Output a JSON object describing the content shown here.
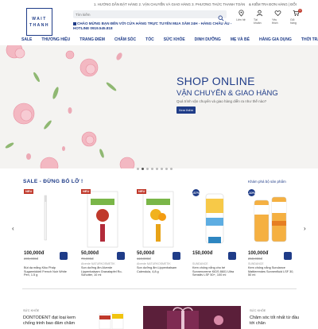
{
  "topbar": {
    "links": "1. HƯỚNG DẪN ĐẶT HÀNG  2. VẬN CHUYỂN VÀ GIAO HÀNG  3. PHƯƠNG THỨC THANH TOÁN",
    "right": "& KIỂM TRA ĐƠN HÀNG | ĐỔI"
  },
  "logo": {
    "line1": "WAIT",
    "line2": "THANH"
  },
  "search": {
    "placeholder": "Tìm kiếm"
  },
  "notice": {
    "line1": "CHÀO MỪNG BẠN ĐẾN VỚI CỬA HÀNG TRỰC TUYẾN MUA SẮM 24H - HÀNG CHÂU ÂU -",
    "line2": "HOTLINE 0919.545.818"
  },
  "header_icons": [
    {
      "label": "Liên hệ",
      "icon": "location-icon"
    },
    {
      "label": "Tài khoản",
      "icon": "user-icon"
    },
    {
      "label": "Yêu thích",
      "icon": "heart-icon"
    },
    {
      "label": "Giỏ hàng",
      "icon": "cart-icon",
      "count": "0"
    }
  ],
  "nav": [
    "SALE",
    "THƯƠNG HIỆU",
    "TRANG ĐIỂM",
    "CHĂM SÓC",
    "TÓC",
    "SỨC KHỎE",
    "DINH DƯỠNG",
    "MẸ VÀ BÉ",
    "HÀNG GIA DỤNG",
    "THỜI TRANG"
  ],
  "hero": {
    "title": "SHOP ONLINE",
    "subtitle": "VẬN CHUYỂN & GIAO HÀNG",
    "desc": "Quá trình vận chuyển và giao hàng diễn ra như thế nào?",
    "button": "Xem thêm"
  },
  "sale": {
    "title": "SALE - ĐỪNG BỎ LỠ !",
    "link": "Khám phá bộ sản phẩm"
  },
  "products": [
    {
      "badge": "NEU",
      "badge_type": "new",
      "price": "100,000đ",
      "old_price": "209,000đ",
      "brand": "",
      "name": "Bút dạ mắng Kiko Phấp Sugarmiddell French Noir White Pen, 1.5 g"
    },
    {
      "badge": "NEU",
      "badge_type": "new",
      "price": "50,000đ",
      "old_price": "79,000đ",
      "brand": "Alverde NATURKOSMETIK",
      "name": "Son dưỡng ẩm Alverde Lippenbalsam Granatapfel Ro-Schutter, 10 ml"
    },
    {
      "badge": "NEU",
      "badge_type": "new",
      "price": "50,000đ",
      "old_price": "118,000đ",
      "brand": "Alverde NATURKOSMETIK",
      "name": "Son dưỡng ẩm Lippenbalsam Calendula, 4,8 g"
    },
    {
      "badge": "-67%",
      "badge_type": "off",
      "price": "150,000đ",
      "old_price": "",
      "brand": "SUNDANCE",
      "name": "Kem chống nắng cho bé Sonnencreme KIDS 8601 Ultra Sensitiv LSF 50+, 100 ml"
    },
    {
      "badge": "-10%",
      "badge_type": "off",
      "price": "100,000đ",
      "old_price": "250,000đ",
      "brand": "SUNDANCE",
      "name": "Kem chống nắng Sundance Mattierendes Sonnenfluid LSF 30, 50 ml"
    }
  ],
  "bottom": [
    {
      "category": "SỨC KHỎE",
      "title": "DONTODENT đạt loại kem chống trinh bao đảm chăm"
    },
    {
      "category": "SỨC KHỎE",
      "title": "Chăm sóc tốt nhất từ đầu tới chân"
    }
  ],
  "colors": {
    "brand": "#1f3c88",
    "sale": "#c0392b"
  }
}
